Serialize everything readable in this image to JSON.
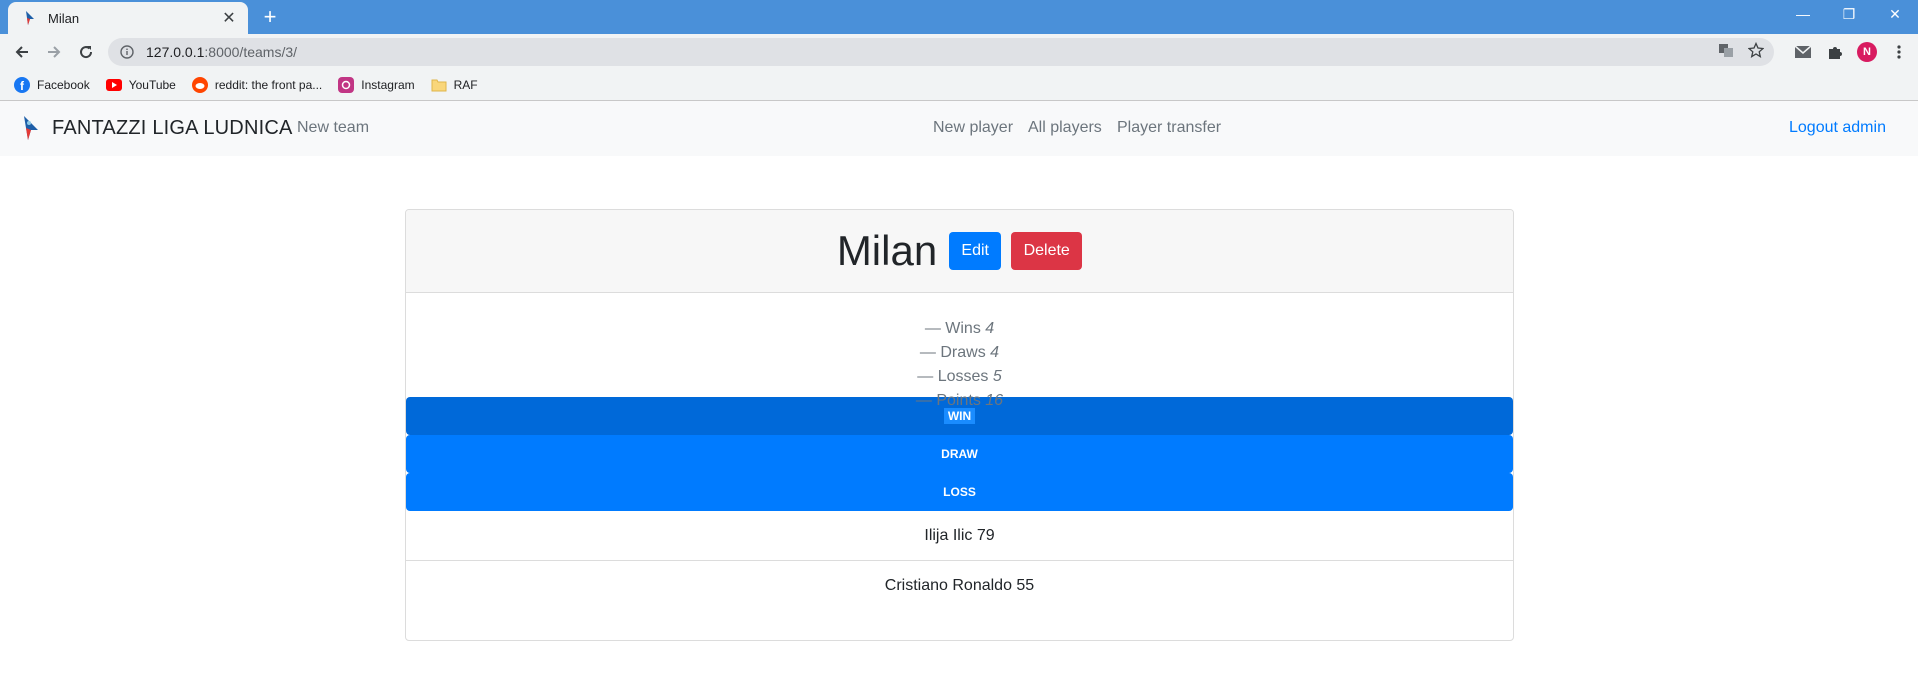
{
  "browser": {
    "tab_title": "Milan",
    "url_host": "127.0.0.1",
    "url_path": ":8000/teams/3/",
    "profile_initial": "N",
    "bookmarks": [
      {
        "label": "Facebook",
        "icon": "facebook-icon"
      },
      {
        "label": "YouTube",
        "icon": "youtube-icon"
      },
      {
        "label": "reddit: the front pa...",
        "icon": "reddit-icon"
      },
      {
        "label": "Instagram",
        "icon": "instagram-icon"
      },
      {
        "label": "RAF",
        "icon": "folder-icon"
      }
    ]
  },
  "navbar": {
    "brand": "FANTAZZI LIGA LUDNICA",
    "new_team": "New team",
    "new_player": "New player",
    "all_players": "All players",
    "player_transfer": "Player transfer",
    "logout": "Logout admin"
  },
  "team": {
    "name": "Milan",
    "edit_label": "Edit",
    "delete_label": "Delete",
    "stats": [
      {
        "label": "Wins",
        "value": "4"
      },
      {
        "label": "Draws",
        "value": "4"
      },
      {
        "label": "Losses",
        "value": "5"
      },
      {
        "label": "Points",
        "value": "16"
      }
    ],
    "stat_prefix": "— ",
    "result_buttons": [
      "WIN",
      "DRAW",
      "LOSS"
    ],
    "players": [
      "Ilija Ilic 79",
      "Cristiano Ronaldo 55"
    ]
  },
  "colors": {
    "primary": "#007bff",
    "danger": "#dc3545",
    "chrome_tabstrip": "#4a90d9"
  }
}
